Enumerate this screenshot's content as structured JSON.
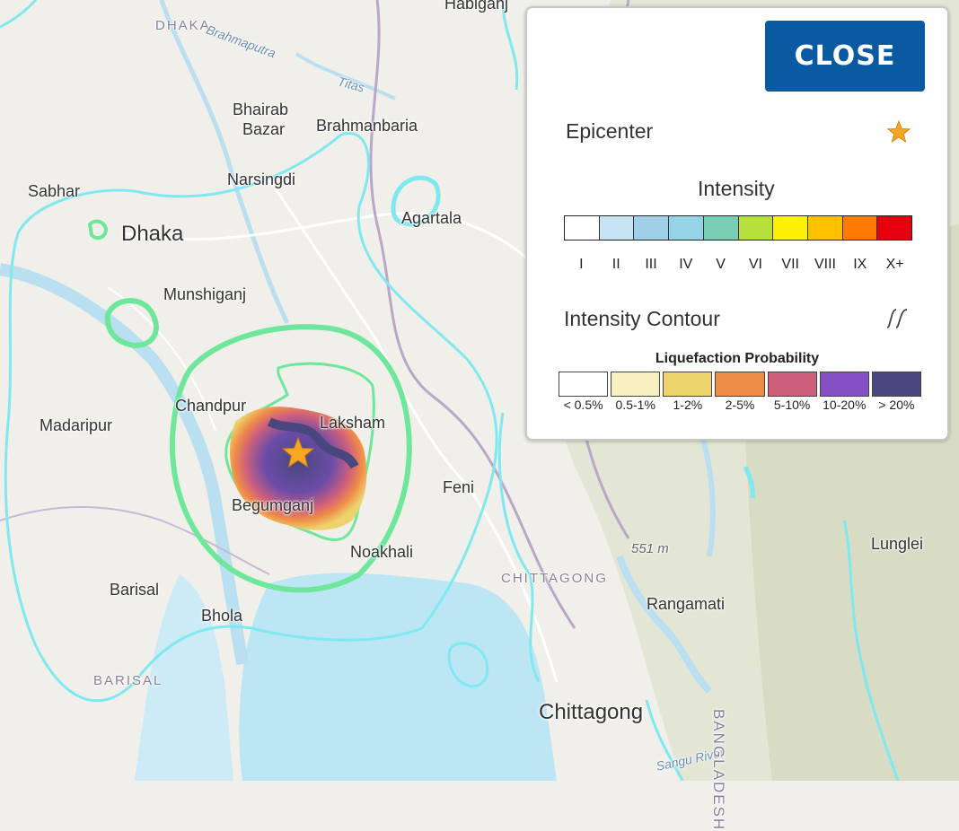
{
  "map": {
    "places": [
      {
        "id": "dhaka-division",
        "text": "DHAKA",
        "cls": "region"
      },
      {
        "id": "habiganj",
        "text": "Habiganj",
        "cls": "city"
      },
      {
        "id": "brahmaputra",
        "text": "Brahmaputra",
        "cls": "river"
      },
      {
        "id": "titas",
        "text": "Titas",
        "cls": "river"
      },
      {
        "id": "bhairab-bazar-1",
        "text": "Bhairab",
        "cls": "city"
      },
      {
        "id": "bhairab-bazar-2",
        "text": "Bazar",
        "cls": "city"
      },
      {
        "id": "brahmanbaria",
        "text": "Brahmanbaria",
        "cls": "city"
      },
      {
        "id": "narsingdi",
        "text": "Narsingdi",
        "cls": "city"
      },
      {
        "id": "sabhar",
        "text": "Sabhar",
        "cls": "city"
      },
      {
        "id": "dhaka",
        "text": "Dhaka",
        "cls": "city-lg"
      },
      {
        "id": "agartala",
        "text": "Agartala",
        "cls": "city"
      },
      {
        "id": "munshiganj",
        "text": "Munshiganj",
        "cls": "city"
      },
      {
        "id": "chandpur",
        "text": "Chandpur",
        "cls": "city"
      },
      {
        "id": "laksham",
        "text": "Laksham",
        "cls": "city"
      },
      {
        "id": "madaripur",
        "text": "Madaripur",
        "cls": "city"
      },
      {
        "id": "feni",
        "text": "Feni",
        "cls": "city"
      },
      {
        "id": "begumganj",
        "text": "Begumganj",
        "cls": "city"
      },
      {
        "id": "noakhali",
        "text": "Noakhali",
        "cls": "city"
      },
      {
        "id": "elevation",
        "text": "551 m",
        "cls": "elev"
      },
      {
        "id": "chittagong-division",
        "text": "CHITTAGONG",
        "cls": "region"
      },
      {
        "id": "lunglei",
        "text": "Lunglei",
        "cls": "city"
      },
      {
        "id": "barisal",
        "text": "Barisal",
        "cls": "city"
      },
      {
        "id": "rangamati",
        "text": "Rangamati",
        "cls": "city"
      },
      {
        "id": "bhola",
        "text": "Bhola",
        "cls": "city"
      },
      {
        "id": "barisal-division",
        "text": "BARISAL",
        "cls": "region"
      },
      {
        "id": "chittagong",
        "text": "Chittagong",
        "cls": "city-lg"
      },
      {
        "id": "sangu-river",
        "text": "Sangu River",
        "cls": "river"
      },
      {
        "id": "bangladesh",
        "text": "BANGLADESH",
        "cls": "region"
      }
    ]
  },
  "legend": {
    "close_label": "CLOSE",
    "epicenter_label": "Epicenter",
    "intensity_title": "Intensity",
    "intensity_scale": [
      {
        "label": "I",
        "color": "#ffffff"
      },
      {
        "label": "II",
        "color": "#c6e4f2"
      },
      {
        "label": "III",
        "color": "#9fd0e8"
      },
      {
        "label": "IV",
        "color": "#96d3e6"
      },
      {
        "label": "V",
        "color": "#78cfb4"
      },
      {
        "label": "VI",
        "color": "#b8e03c"
      },
      {
        "label": "VII",
        "color": "#fff200"
      },
      {
        "label": "VIII",
        "color": "#ffc000"
      },
      {
        "label": "IX",
        "color": "#ff7a00"
      },
      {
        "label": "X+",
        "color": "#e8000f"
      }
    ],
    "contour_label": "Intensity Contour",
    "liquefaction_title": "Liquefaction Probability",
    "liquefaction_scale": [
      {
        "label": "< 0.5%",
        "color": "#ffffff"
      },
      {
        "label": "0.5-1%",
        "color": "#f7f0c0"
      },
      {
        "label": "1-2%",
        "color": "#ecd36c"
      },
      {
        "label": "2-5%",
        "color": "#ef8c48"
      },
      {
        "label": "5-10%",
        "color": "#cf607c"
      },
      {
        "label": "10-20%",
        "color": "#8450c4"
      },
      {
        "label": "> 20%",
        "color": "#4a467e"
      }
    ],
    "colors": {
      "accent": "#0a5aa2",
      "star": "#f5a623",
      "contour_high": "#6ee69c",
      "contour_low": "#7fe8f0"
    }
  }
}
